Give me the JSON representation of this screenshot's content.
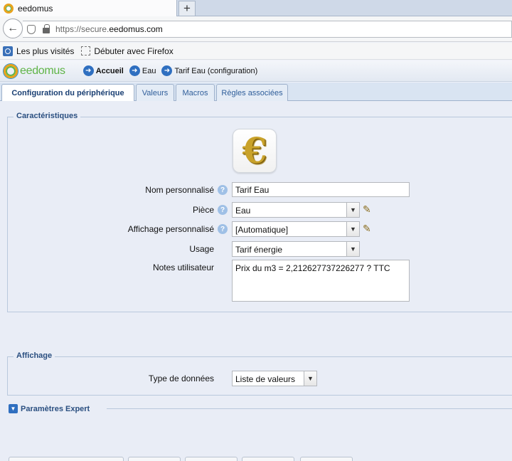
{
  "browser": {
    "tab_title": "eedomus",
    "new_tab_symbol": "+",
    "url_prefix": "https://secure.",
    "url_domain": "eedomus.com",
    "bookmarks": [
      {
        "label": "Les plus visités"
      },
      {
        "label": "Débuter avec Firefox"
      }
    ]
  },
  "app": {
    "logo_text": "eedomus",
    "breadcrumb": [
      {
        "label": "Accueil"
      },
      {
        "label": "Eau"
      },
      {
        "label": "Tarif Eau (configuration)"
      }
    ],
    "tabs": [
      {
        "label": "Configuration du périphérique",
        "active": true
      },
      {
        "label": "Valeurs"
      },
      {
        "label": "Macros"
      },
      {
        "label": "Règles associées"
      }
    ]
  },
  "characteristics": {
    "legend": "Caractéristiques",
    "icon_symbol": "€",
    "icon_name": "euro-icon",
    "fields": {
      "name_label": "Nom personnalisé",
      "name_value": "Tarif Eau",
      "room_label": "Pièce",
      "room_value": "Eau",
      "display_label": "Affichage personnalisé",
      "display_value": "[Automatique]",
      "usage_label": "Usage",
      "usage_value": "Tarif énergie",
      "notes_label": "Notes utilisateur",
      "notes_value": "Prix du m3 = 2,212627737226277 ? TTC"
    }
  },
  "display_section": {
    "legend": "Affichage",
    "type_label": "Type de données",
    "type_value": "Liste de valeurs"
  },
  "expert": {
    "label": "Paramètres Expert"
  },
  "colors": {
    "accent": "#2f6fc0",
    "legend_text": "#2a4f80",
    "logo_green": "#5fb447",
    "logo_orange": "#e8a21c"
  }
}
